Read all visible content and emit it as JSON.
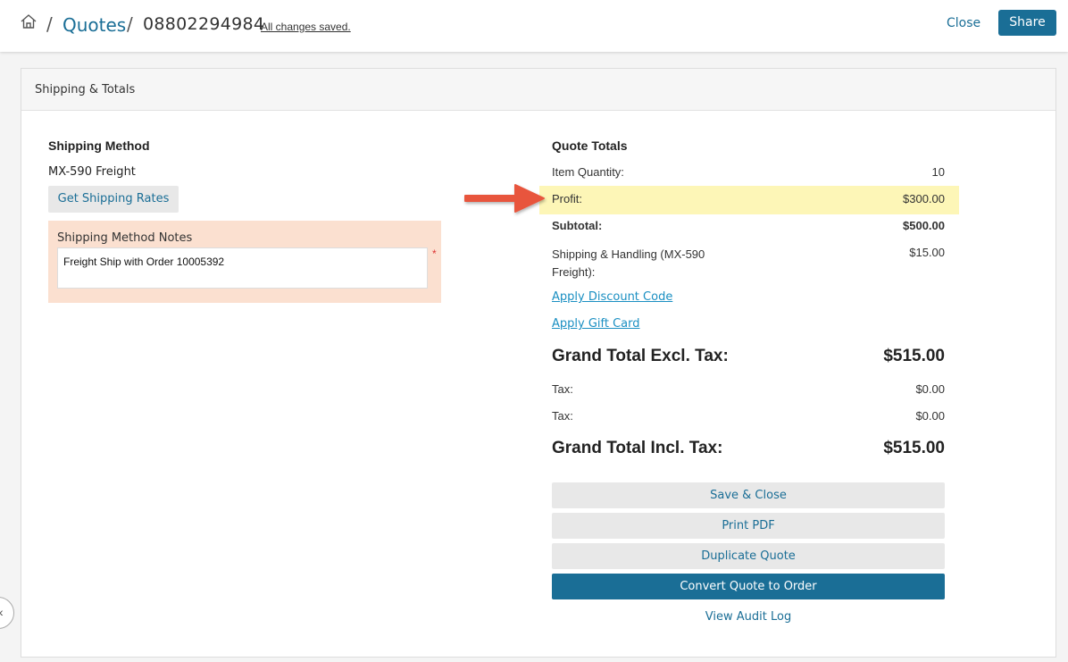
{
  "header": {
    "home_icon": "home-icon",
    "sep1": "/",
    "sep2": "/",
    "breadcrumb_quotes": "Quotes",
    "quote_id": "08802294984",
    "save_status": "All changes saved.",
    "close_label": "Close",
    "share_label": "Share"
  },
  "panel": {
    "title": "Shipping & Totals"
  },
  "shipping": {
    "title": "Shipping Method",
    "method": "MX-590 Freight",
    "rates_button": "Get Shipping Rates",
    "notes_label": "Shipping Method Notes",
    "notes_value": "Freight Ship with Order 10005392",
    "required_mark": "*"
  },
  "totals": {
    "title": "Quote Totals",
    "item_quantity_label": "Item Quantity:",
    "item_quantity_value": "10",
    "profit_label": "Profit:",
    "profit_value": "$300.00",
    "subtotal_label": "Subtotal:",
    "subtotal_value": "$500.00",
    "shipping_label_1": "Shipping & Handling (MX-590",
    "shipping_label_2": "Freight):",
    "shipping_value": "$15.00",
    "discount_link": "Apply Discount Code",
    "gift_link": "Apply Gift Card",
    "grand_excl_label": "Grand Total Excl. Tax:",
    "grand_excl_value": "$515.00",
    "tax1_label": "Tax:",
    "tax1_value": "$0.00",
    "tax2_label": "Tax:",
    "tax2_value": "$0.00",
    "grand_incl_label": "Grand Total Incl. Tax:",
    "grand_incl_value": "$515.00"
  },
  "actions": {
    "save_close": "Save & Close",
    "print_pdf": "Print PDF",
    "duplicate": "Duplicate Quote",
    "convert": "Convert Quote to Order",
    "audit_log": "View Audit Log"
  },
  "colors": {
    "accent": "#1a6e96",
    "link": "#1a8fc2",
    "highlight": "#fdf6b7",
    "notes_bg": "#fbe0d0",
    "annotation_arrow": "#e8553e"
  },
  "icons": {
    "arrow": "annotation-arrow",
    "side_toggle": "chevron-left-icon"
  }
}
